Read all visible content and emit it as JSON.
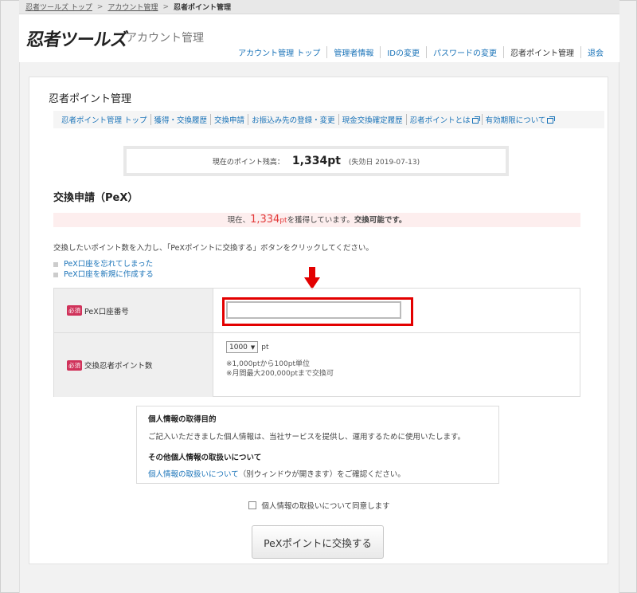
{
  "breadcrumb": {
    "items": [
      "忍者ツールズ トップ",
      "アカウント管理"
    ],
    "current": "忍者ポイント管理"
  },
  "header": {
    "logo": "忍者ツールズ",
    "subtitle": "アカウント管理"
  },
  "topnav": [
    "アカウント管理 トップ",
    "管理者情報",
    "IDの変更",
    "パスワードの変更",
    "忍者ポイント管理",
    "退会"
  ],
  "card": {
    "title": "忍者ポイント管理"
  },
  "subnav": [
    "忍者ポイント管理 トップ",
    "獲得・交換履歴",
    "交換申請",
    "お振込み先の登録・変更",
    "現金交換確定履歴",
    "忍者ポイントとは",
    "有効期限について"
  ],
  "balance": {
    "label": "現在のポイント残高：",
    "amount": "1,334pt",
    "expiry": "(失効日 2019-07-13)"
  },
  "section": {
    "title": "交換申請（PeX）"
  },
  "notice": {
    "prefix": "現在、",
    "points": "1,334",
    "unit": "pt",
    "middle": "を獲得しています。",
    "status": "交換可能です。"
  },
  "instruction": "交換したいポイント数を入力し、「PeXポイントに交換する」ボタンをクリックしてください。",
  "links": [
    "PeX口座を忘れてしまった",
    "PeX口座を新規に作成する"
  ],
  "form": {
    "required_badge": "必須",
    "pex_label": "PeX口座番号",
    "pex_value": "",
    "points_label": "交換忍者ポイント数",
    "points_selected": "1000",
    "points_unit": "pt",
    "hint1": "※1,000ptから100pt単位",
    "hint2": "※月間最大200,000ptまで交換可"
  },
  "privacy": {
    "heading1": "個人情報の取得目的",
    "text1": "ご記入いただきました個人情報は、当社サービスを提供し、運用するために使用いたします。",
    "heading2": "その他個人情報の取扱いについて",
    "link": "個人情報の取扱いについて",
    "text2": "（別ウィンドウが開きます）をご確認ください。"
  },
  "agree_label": "個人情報の取扱いについて同意します",
  "submit_label": "PeXポイントに交換する",
  "colors": {
    "link": "#1a73b8",
    "accent_red": "#e23a3a",
    "highlight": "#e30000",
    "required": "#d0325a"
  }
}
